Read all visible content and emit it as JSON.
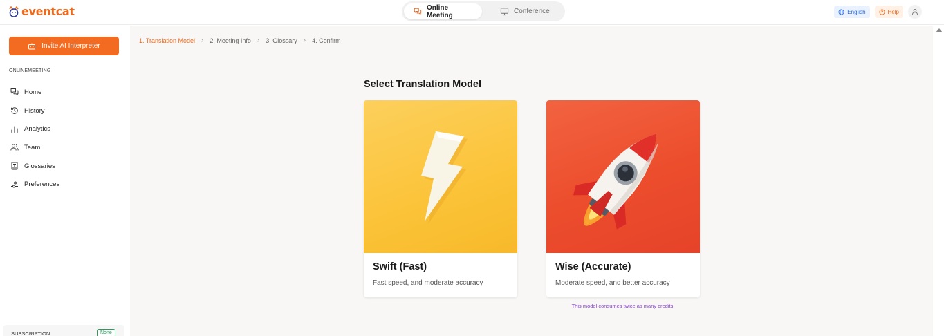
{
  "app": {
    "brand": "eventcat",
    "brand_color": "#ea6a1f"
  },
  "header": {
    "modes": [
      {
        "label": "Online Meeting",
        "icon": "chat-bubbles-icon",
        "active": true
      },
      {
        "label": "Conference",
        "icon": "monitor-icon",
        "active": false
      }
    ],
    "language_label": "English",
    "help_label": "Help"
  },
  "sidebar": {
    "invite_label": "Invite AI Interpreter",
    "section_heading": "ONLINEMEETING",
    "items": [
      {
        "label": "Home",
        "icon": "chat-bubbles-icon"
      },
      {
        "label": "History",
        "icon": "history-icon"
      },
      {
        "label": "Analytics",
        "icon": "bar-chart-icon"
      },
      {
        "label": "Team",
        "icon": "users-icon"
      },
      {
        "label": "Glossaries",
        "icon": "book-icon"
      },
      {
        "label": "Preferences",
        "icon": "sliders-icon"
      }
    ],
    "subscription_label": "SUBSCRIPTION",
    "subscription_badge": "None"
  },
  "breadcrumb": [
    {
      "label": "1. Translation Model",
      "active": true
    },
    {
      "label": "2. Meeting Info",
      "active": false
    },
    {
      "label": "3. Glossary",
      "active": false
    },
    {
      "label": "4. Confirm",
      "active": false
    }
  ],
  "main": {
    "title": "Select Translation Model",
    "cards": [
      {
        "title": "Swift (Fast)",
        "description": "Fast speed, and moderate accuracy",
        "image": "lightning-bolt-icon",
        "bg_color": "#fbc338"
      },
      {
        "title": "Wise (Accurate)",
        "description": "Moderate speed, and better accuracy",
        "image": "rocket-icon",
        "bg_color": "#ec4d2c"
      }
    ],
    "wise_note": "This model consumes twice as many credits."
  },
  "colors": {
    "accent": "#f26b21",
    "note": "#8b3fd9",
    "badge_green": "#22a05b"
  }
}
